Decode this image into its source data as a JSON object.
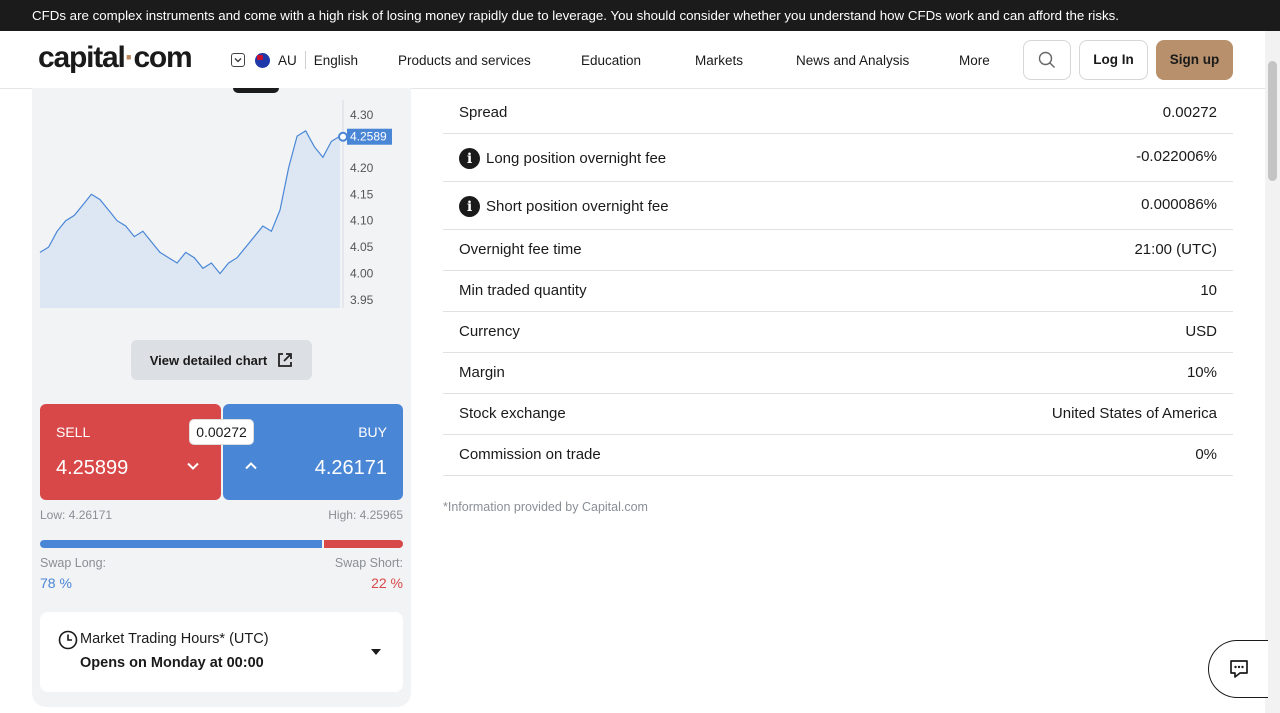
{
  "risk_banner": "CFDs are complex instruments and come with a high risk of losing money rapidly due to leverage. You should consider whether you understand how CFDs work and can afford the risks.",
  "header": {
    "logo_main": "capital",
    "logo_dot": "·",
    "logo_end": "com",
    "region": "AU",
    "language": "English",
    "nav": [
      "Products and services",
      "Education",
      "Markets",
      "News and Analysis",
      "More"
    ],
    "login": "Log In",
    "signup": "Sign up"
  },
  "chart": {
    "y_ticks": [
      "4.30",
      "4.20",
      "4.15",
      "4.10",
      "4.05",
      "4.00",
      "3.95"
    ],
    "current_label": "4.2589",
    "line_color": "#4a86d6"
  },
  "chart_data": {
    "type": "area",
    "y": [
      4.04,
      4.05,
      4.08,
      4.1,
      4.11,
      4.13,
      4.15,
      4.14,
      4.12,
      4.1,
      4.09,
      4.07,
      4.08,
      4.06,
      4.04,
      4.03,
      4.02,
      4.04,
      4.03,
      4.01,
      4.02,
      4.0,
      4.02,
      4.03,
      4.05,
      4.07,
      4.09,
      4.08,
      4.12,
      4.2,
      4.26,
      4.27,
      4.24,
      4.22,
      4.25,
      4.26
    ],
    "ylim": [
      3.95,
      4.3
    ],
    "current_value": 4.2589,
    "grid": false
  },
  "view_chart_label": "View detailed chart",
  "trade": {
    "sell_label": "SELL",
    "sell_price": "4.25899",
    "buy_label": "BUY",
    "buy_price": "4.26171",
    "spread": "0.00272",
    "low": "Low: 4.26171",
    "high": "High: 4.25965",
    "swap_long_label": "Swap Long:",
    "swap_long_value": "78 %",
    "swap_long_fraction": 0.78,
    "swap_short_label": "Swap Short:",
    "swap_short_value": "22 %",
    "long_color": "#4a86d6",
    "short_color": "#d94848"
  },
  "hours": {
    "title": "Market Trading Hours* (UTC)",
    "subtitle": "Opens on Monday at 00:00"
  },
  "details": [
    {
      "label": "Spread",
      "value": "0.00272",
      "info": false
    },
    {
      "label": "Long position overnight fee",
      "value": "-0.022006%",
      "info": true
    },
    {
      "label": "Short position overnight fee",
      "value": "0.000086%",
      "info": true
    },
    {
      "label": "Overnight fee time",
      "value": "21:00 (UTC)",
      "info": false
    },
    {
      "label": "Min traded quantity",
      "value": "10",
      "info": false
    },
    {
      "label": "Currency",
      "value": "USD",
      "info": false
    },
    {
      "label": "Margin",
      "value": "10%",
      "info": false
    },
    {
      "label": "Stock exchange",
      "value": "United States of America",
      "info": false
    },
    {
      "label": "Commission on trade",
      "value": "0%",
      "info": false
    }
  ],
  "note": "*Information provided by Capital.com"
}
